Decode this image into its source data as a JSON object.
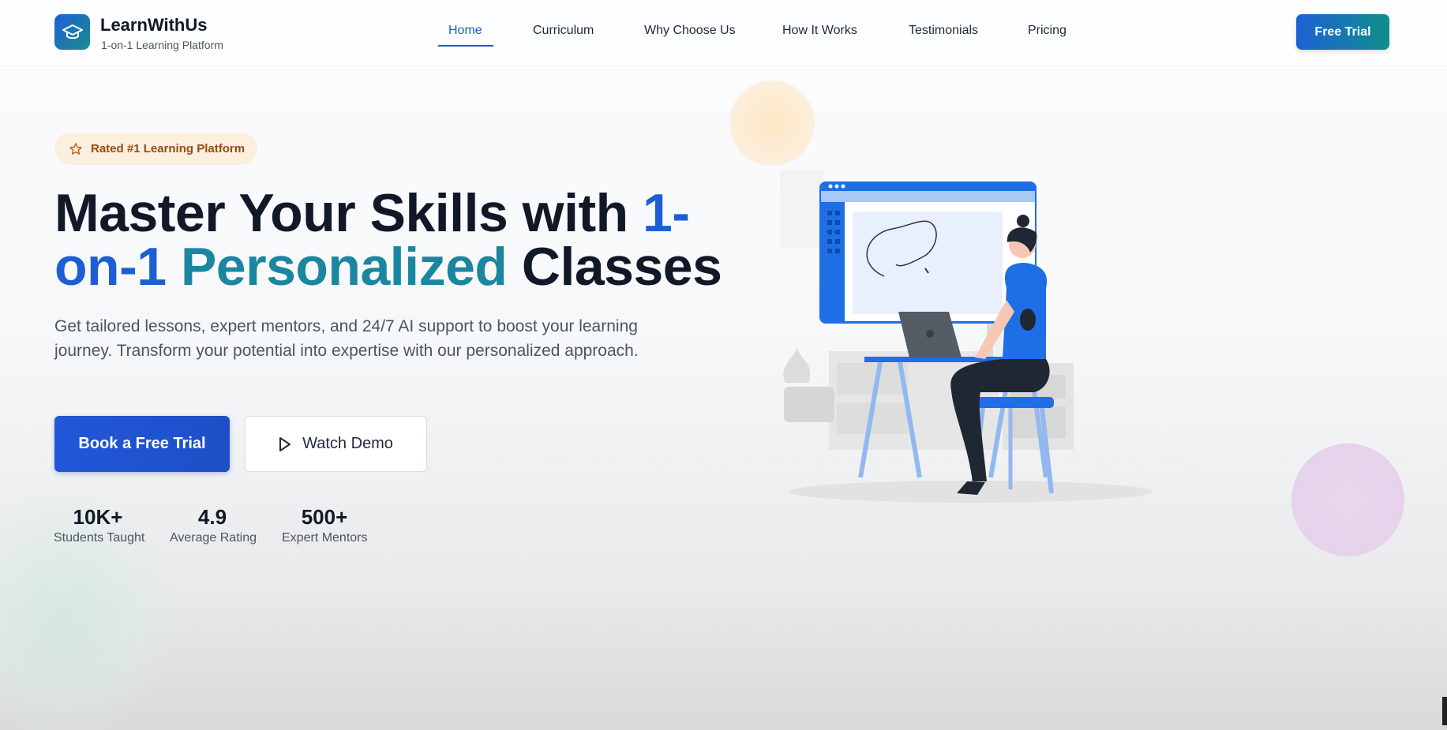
{
  "header": {
    "brand_name": "LearnWithUs",
    "brand_tagline": "1-on-1 Learning Platform",
    "logo_icon": "graduation-cap-icon",
    "nav": [
      {
        "label": "Home",
        "active": true
      },
      {
        "label": "Curriculum",
        "active": false
      },
      {
        "label": "Why Choose Us",
        "active": false
      },
      {
        "label": "How It Works",
        "active": false
      },
      {
        "label": "Testimonials",
        "active": false
      },
      {
        "label": "Pricing",
        "active": false
      }
    ],
    "cta_label": "Free Trial"
  },
  "hero": {
    "badge_icon": "star-icon",
    "badge_text": "Rated #1 Learning Platform",
    "headline": {
      "part1": "Master Your Skills with ",
      "part2": "1-",
      "part3": "on-1 ",
      "part4": "Personalized",
      "part5": " Classes"
    },
    "description": "Get tailored lessons, expert mentors, and 24/7 AI support to boost your learning journey. Transform your potential into expertise with our personalized approach.",
    "primary_button": "Book a Free Trial",
    "secondary_button": "Watch Demo",
    "secondary_icon": "play-icon",
    "stats": [
      {
        "value": "10K+",
        "label": "Students Taught"
      },
      {
        "value": "4.9",
        "label": "Average Rating"
      },
      {
        "value": "500+",
        "label": "Expert Mentors"
      }
    ]
  },
  "colors": {
    "primary_blue": "#1d5fd3",
    "teal": "#1fa08a",
    "badge_bg": "#fcefdf",
    "badge_text": "#9a4a12"
  }
}
